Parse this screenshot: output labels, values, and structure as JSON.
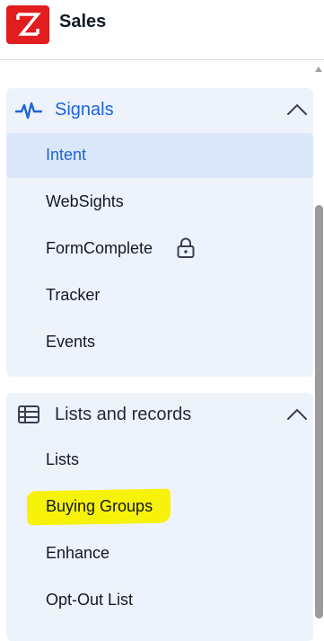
{
  "header": {
    "title": "Sales"
  },
  "sections": {
    "signals": {
      "title": "Signals",
      "items": [
        {
          "label": "Intent"
        },
        {
          "label": "WebSights"
        },
        {
          "label": "FormComplete"
        },
        {
          "label": "Tracker"
        },
        {
          "label": "Events"
        }
      ]
    },
    "lists": {
      "title": "Lists and records",
      "items": [
        {
          "label": "Lists"
        },
        {
          "label": "Buying Groups"
        },
        {
          "label": "Enhance"
        },
        {
          "label": "Opt-Out List"
        }
      ]
    }
  },
  "colors": {
    "brand": "#e11d1d",
    "accent": "#1d64d8",
    "active_bg": "#dbe8fb",
    "section_bg": "#eef3fb",
    "highlight": "#f6f20a"
  },
  "icons": {
    "logo": "zoominfo-z-logo",
    "signals": "pulse-icon",
    "lists": "table-icon",
    "chevron": "chevron-up-icon",
    "lock": "lock-icon"
  }
}
